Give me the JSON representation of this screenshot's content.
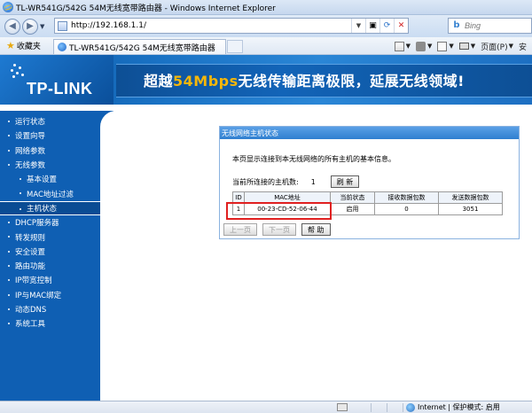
{
  "browser": {
    "window_title": "TL-WR541G/542G 54M无线宽带路由器 - Windows Internet Explorer",
    "address_url": "http://192.168.1.1/",
    "search_placeholder": "Bing",
    "favorites_label": "收藏夹",
    "tab_label": "TL-WR541G/542G 54M无线宽带路由器",
    "command_page_label": "页面(P)",
    "command_more_label": "安",
    "status_zone_text": "Internet | 保护模式: 启用"
  },
  "banner": {
    "logo_text": "TP-LINK",
    "slogan_prefix": "超越",
    "slogan_highlight": "54Mbps",
    "slogan_suffix": "无线传输距离极限，延展无线领域!"
  },
  "menu": {
    "items": [
      {
        "label": "运行状态"
      },
      {
        "label": "设置向导"
      },
      {
        "label": "网络参数"
      },
      {
        "label": "无线参数"
      },
      {
        "label": "基本设置"
      },
      {
        "label": "MAC地址过滤"
      },
      {
        "label": "主机状态"
      },
      {
        "label": "DHCP服务器"
      },
      {
        "label": "转发规则"
      },
      {
        "label": "安全设置"
      },
      {
        "label": "路由功能"
      },
      {
        "label": "IP带宽控制"
      },
      {
        "label": "IP与MAC绑定"
      },
      {
        "label": "动态DNS"
      },
      {
        "label": "系统工具"
      }
    ]
  },
  "panel": {
    "title": "无线网络主机状态",
    "description": "本页显示连接到本无线网络的所有主机的基本信息。",
    "count_label": "当前所连接的主机数:",
    "count_value": "1",
    "refresh_label": "刷 新",
    "table": {
      "headers": [
        "ID",
        "MAC地址",
        "当前状态",
        "接收数据包数",
        "发送数据包数"
      ],
      "rows": [
        {
          "id": "1",
          "mac": "00-23-CD-52-06-44",
          "status": "启用",
          "rx": "0",
          "tx": "3051"
        }
      ]
    },
    "prev_label": "上一页",
    "next_label": "下一页",
    "help_label": "帮 助"
  },
  "colors": {
    "sidebar_blue": "#0f5fb3",
    "banner_blue": "#1a72c4",
    "slogan_highlight": "#f5b70a",
    "highlight_border": "#e02020"
  }
}
